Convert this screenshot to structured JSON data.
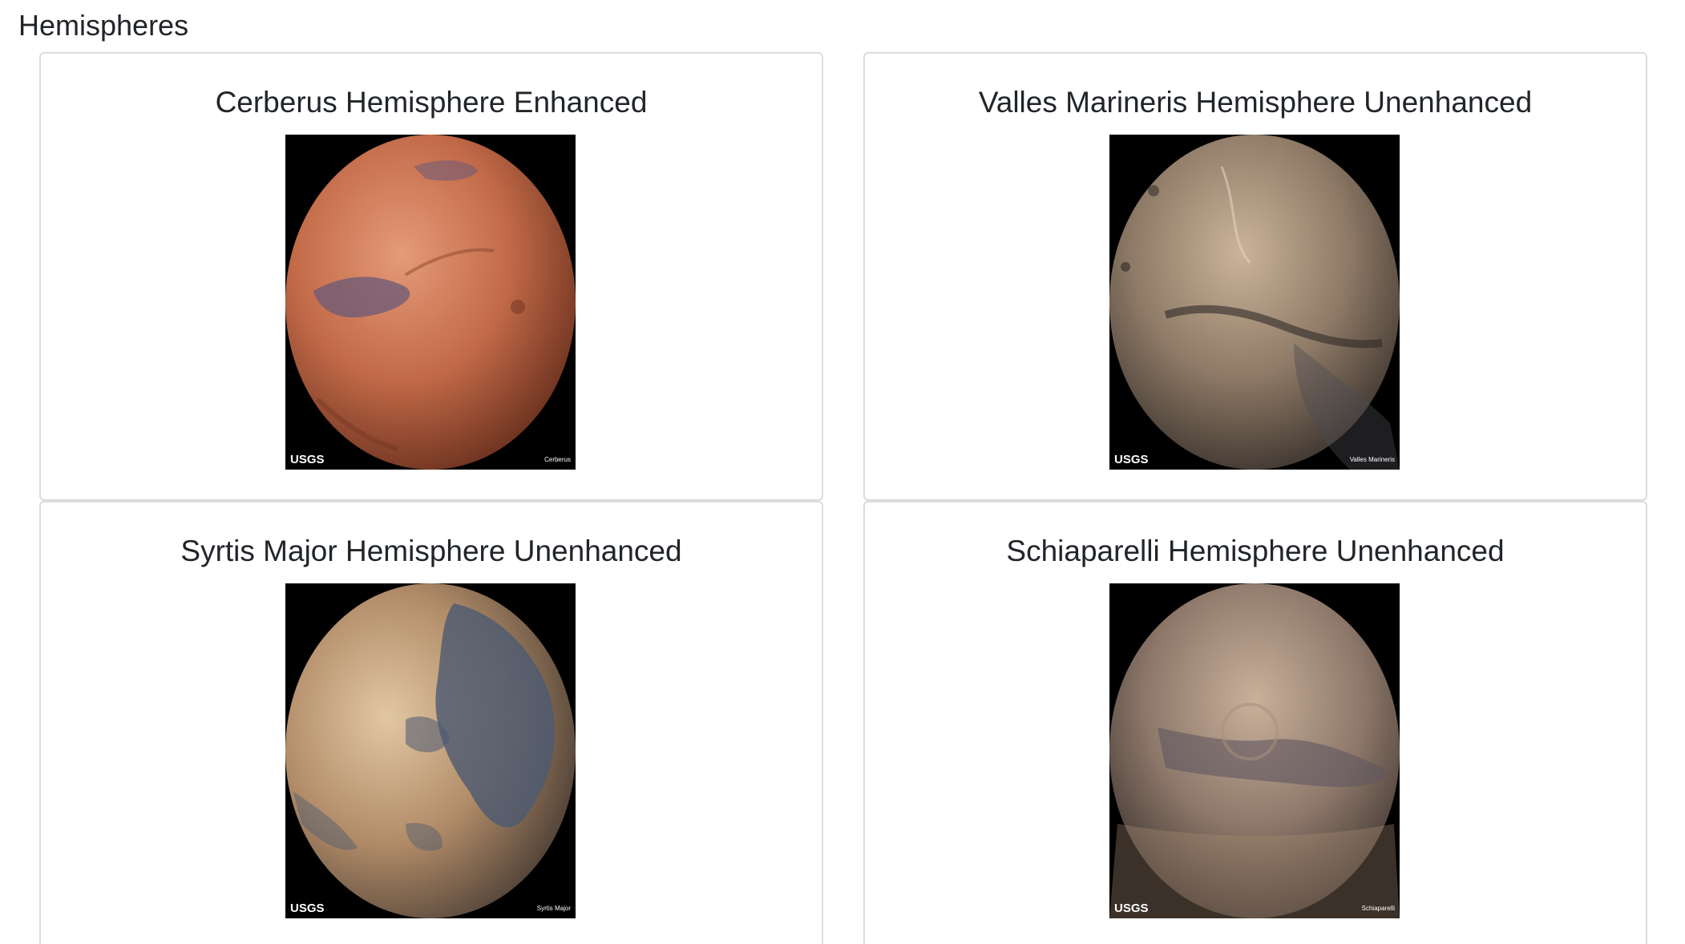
{
  "section": {
    "title": "Hemispheres"
  },
  "hemispheres": [
    {
      "title": "Cerberus Hemisphere Enhanced",
      "image": {
        "watermark_logo": "USGS",
        "label": "Cerberus",
        "icon": "mars-hemisphere-image",
        "colors": {
          "light": "#e59a78",
          "base": "#c26a48",
          "dark": "#6e3320",
          "mare": "#6a5a78"
        }
      }
    },
    {
      "title": "Valles Marineris Hemisphere Unenhanced",
      "image": {
        "watermark_logo": "USGS",
        "label": "Valles Marineris",
        "icon": "mars-hemisphere-image",
        "colors": {
          "light": "#cbb39a",
          "base": "#8e7a66",
          "dark": "#3f3630",
          "mare": "#4a4a52"
        }
      }
    },
    {
      "title": "Syrtis Major Hemisphere Unenhanced",
      "image": {
        "watermark_logo": "USGS",
        "label": "Syrtis Major",
        "icon": "mars-hemisphere-image",
        "colors": {
          "light": "#e2c7a4",
          "base": "#b28c68",
          "dark": "#55463a",
          "mare": "#4b5a72"
        }
      }
    },
    {
      "title": "Schiaparelli Hemisphere Unenhanced",
      "image": {
        "watermark_logo": "USGS",
        "label": "Schiaparelli",
        "icon": "mars-hemisphere-image",
        "colors": {
          "light": "#c9b09a",
          "base": "#8e786a",
          "dark": "#3a322e",
          "mare": "#5f5660"
        }
      }
    }
  ]
}
